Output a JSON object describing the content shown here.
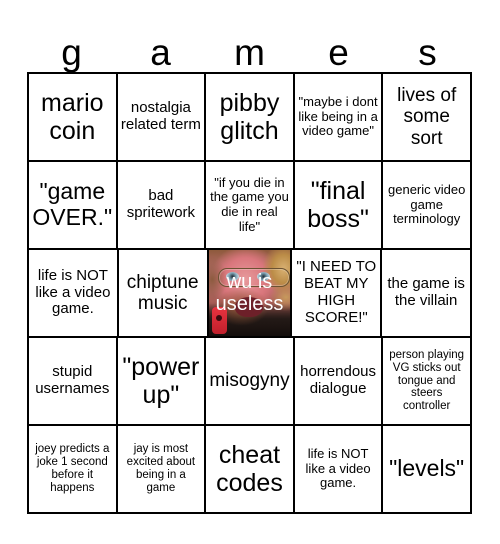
{
  "card": {
    "title_letters": [
      "g",
      "a",
      "m",
      "e",
      "s"
    ],
    "title_text": "games",
    "rows": [
      [
        {
          "text": "mario coin",
          "size": "xl"
        },
        {
          "text": "nostalgia related term",
          "size": "sm"
        },
        {
          "text": "pibby glitch",
          "size": "xl"
        },
        {
          "text": "\"maybe i dont like being in a video game\"",
          "size": "xs"
        },
        {
          "text": "lives of some sort",
          "size": "md"
        }
      ],
      [
        {
          "text": "\"game OVER.\"",
          "size": "lg"
        },
        {
          "text": "bad spritework",
          "size": "sm"
        },
        {
          "text": "\"if you die in the game you die in real life\"",
          "size": "xs"
        },
        {
          "text": "\"final boss\"",
          "size": "xl"
        },
        {
          "text": "generic video game terminology",
          "size": "xs"
        }
      ],
      [
        {
          "text": "life is NOT like a video game.",
          "size": "sm"
        },
        {
          "text": "chiptune music",
          "size": "md"
        },
        {
          "text": "wu is useless",
          "size": "md",
          "photo": true
        },
        {
          "text": "\"I NEED TO BEAT MY HIGH SCORE!\"",
          "size": "sm"
        },
        {
          "text": "the game is the villain",
          "size": "sm"
        }
      ],
      [
        {
          "text": "stupid usernames",
          "size": "sm"
        },
        {
          "text": "\"power up\"",
          "size": "xl"
        },
        {
          "text": "misogyny",
          "size": "md"
        },
        {
          "text": "horrendous dialogue",
          "size": "sm"
        },
        {
          "text": "person playing VG sticks out tongue and steers controller",
          "size": "xxs"
        }
      ],
      [
        {
          "text": "joey predicts a joke 1 second before it happens",
          "size": "xxs"
        },
        {
          "text": "jay is most excited about being in a game",
          "size": "xxs"
        },
        {
          "text": "cheat codes",
          "size": "xl"
        },
        {
          "text": "life is NOT like a video game.",
          "size": "xs"
        },
        {
          "text": "\"levels\"",
          "size": "lg"
        }
      ]
    ],
    "free_space": {
      "caption_line_1": "wu is",
      "caption_line_2": "useless",
      "caption": "wu is useless"
    },
    "colors": {
      "background": "#ffffff",
      "text": "#000000",
      "grid_line": "#000000",
      "caption_text": "#ffffff"
    }
  }
}
